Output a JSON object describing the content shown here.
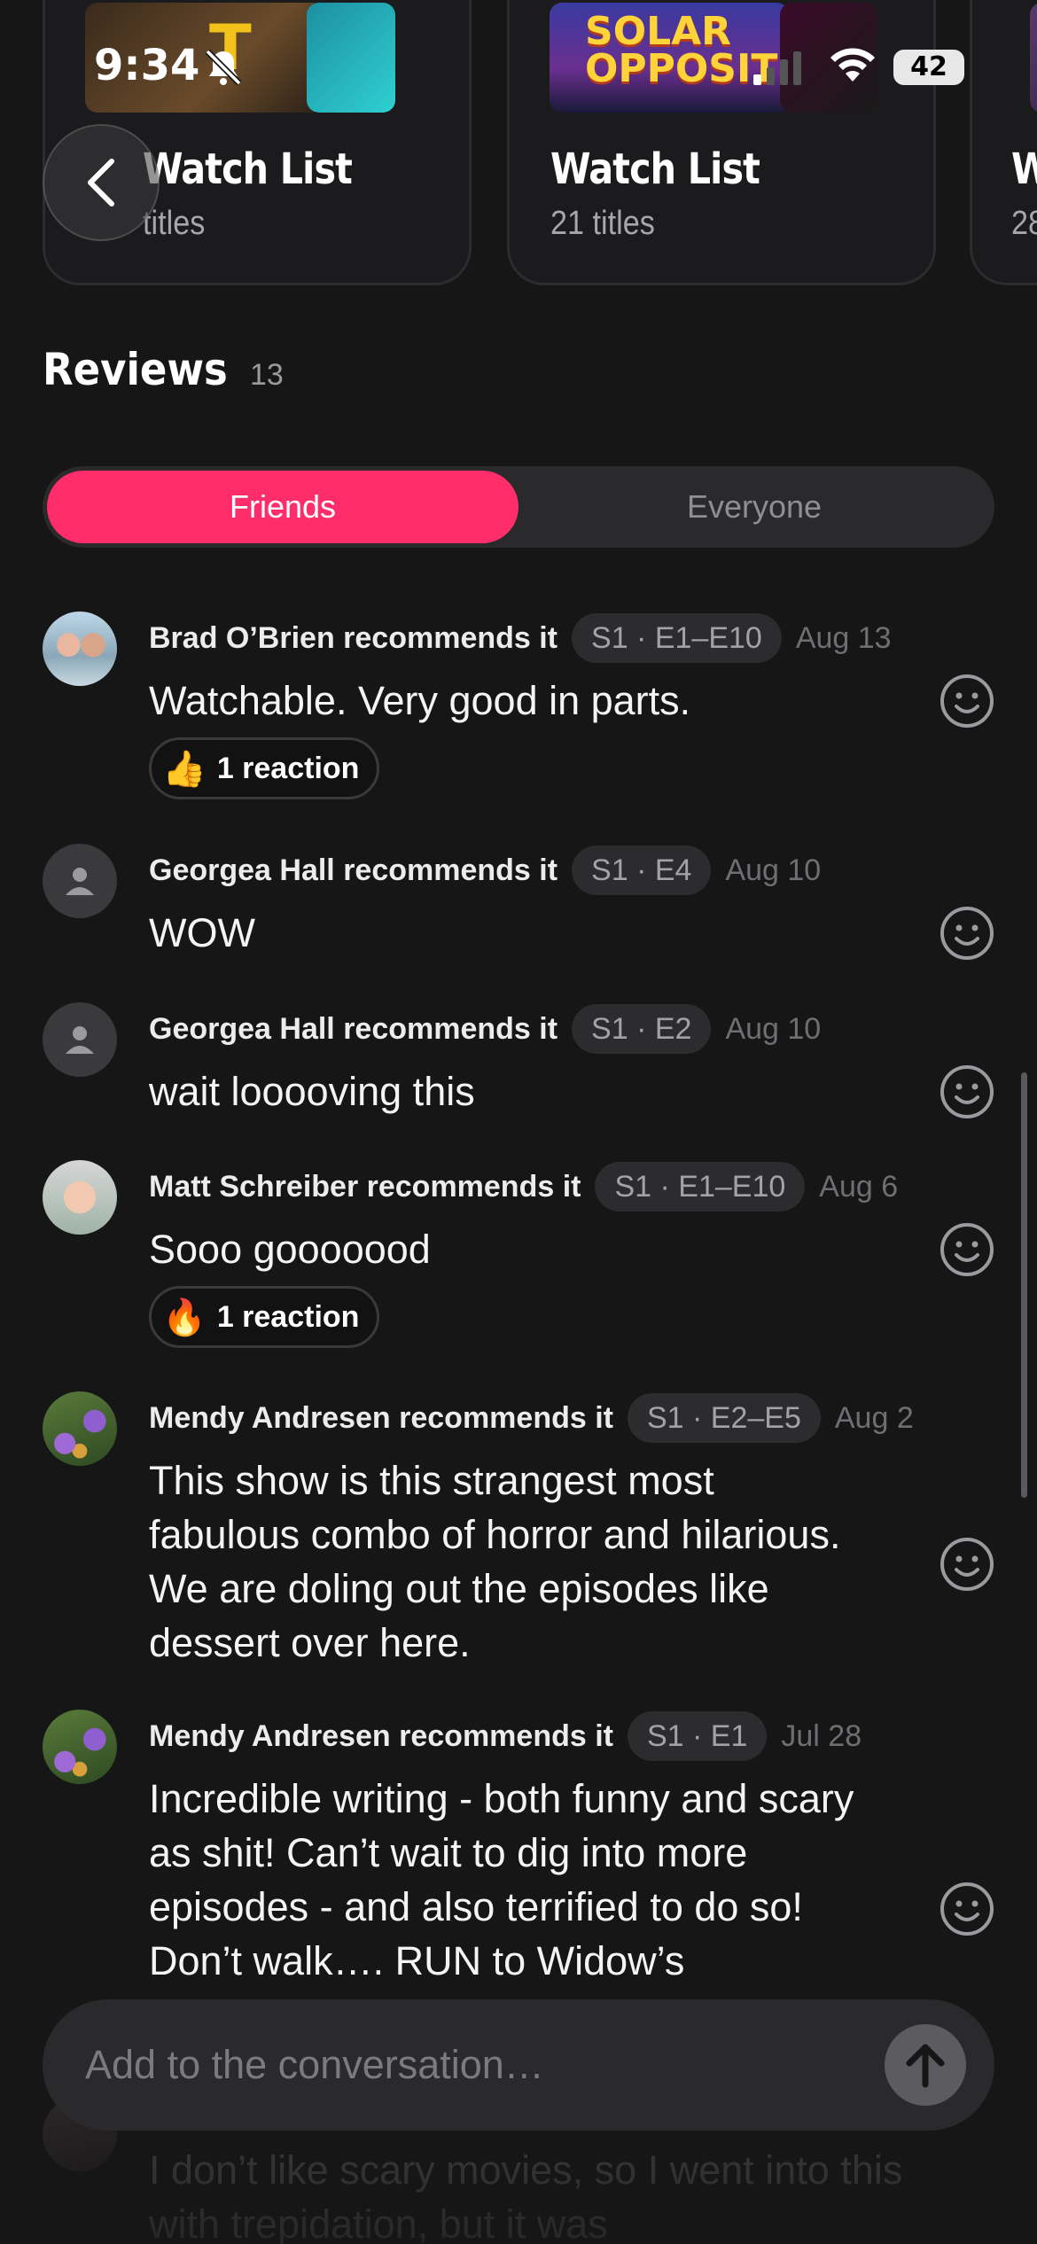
{
  "status": {
    "time": "9:34",
    "battery": "42"
  },
  "lists": [
    {
      "title": "Watch List",
      "count": "titles",
      "poster_text": "T"
    },
    {
      "title": "Watch List",
      "count": "21 titles",
      "poster_text": "SOLAR OPPOSITES"
    },
    {
      "title": "W",
      "count": "28"
    }
  ],
  "reviews": {
    "title": "Reviews",
    "count": "13",
    "tabs": {
      "friends": "Friends",
      "everyone": "Everyone"
    },
    "items": [
      {
        "author_line": "Brad O’Brien recommends it",
        "episodes": "S1 · E1–E10",
        "date": "Aug 13",
        "text": "Watchable. Very good in parts.",
        "reaction": {
          "emoji": "👍",
          "label": "1 reaction"
        }
      },
      {
        "author_line": "Georgea Hall recommends it",
        "episodes": "S1 · E4",
        "date": "Aug 10",
        "text": "WOW"
      },
      {
        "author_line": "Georgea Hall recommends it",
        "episodes": "S1 · E2",
        "date": "Aug 10",
        "text": "wait looooving this"
      },
      {
        "author_line": "Matt Schreiber recommends it",
        "episodes": "S1 · E1–E10",
        "date": "Aug 6",
        "text": "Sooo gooooood",
        "reaction": {
          "emoji": "🔥",
          "label": "1 reaction"
        }
      },
      {
        "author_line": "Mendy Andresen recommends it",
        "episodes": "S1 · E2–E5",
        "date": "Aug 2",
        "text": "This show is this strangest most fabulous combo of horror and hilarious. We are doling out the episodes like dessert over here."
      },
      {
        "author_line": "Mendy Andresen recommends it",
        "episodes": "S1 · E1",
        "date": "Jul 28",
        "text": "Incredible writing - both funny and scary as shit! Can’t wait to dig into more episodes - and also terrified to do so! Don’t walk…. RUN to Widow’s"
      },
      {
        "text": "I don’t like scary movies, so I went into this with trepidation, but it was"
      }
    ]
  },
  "composer": {
    "placeholder": "Add to the conversation…"
  }
}
